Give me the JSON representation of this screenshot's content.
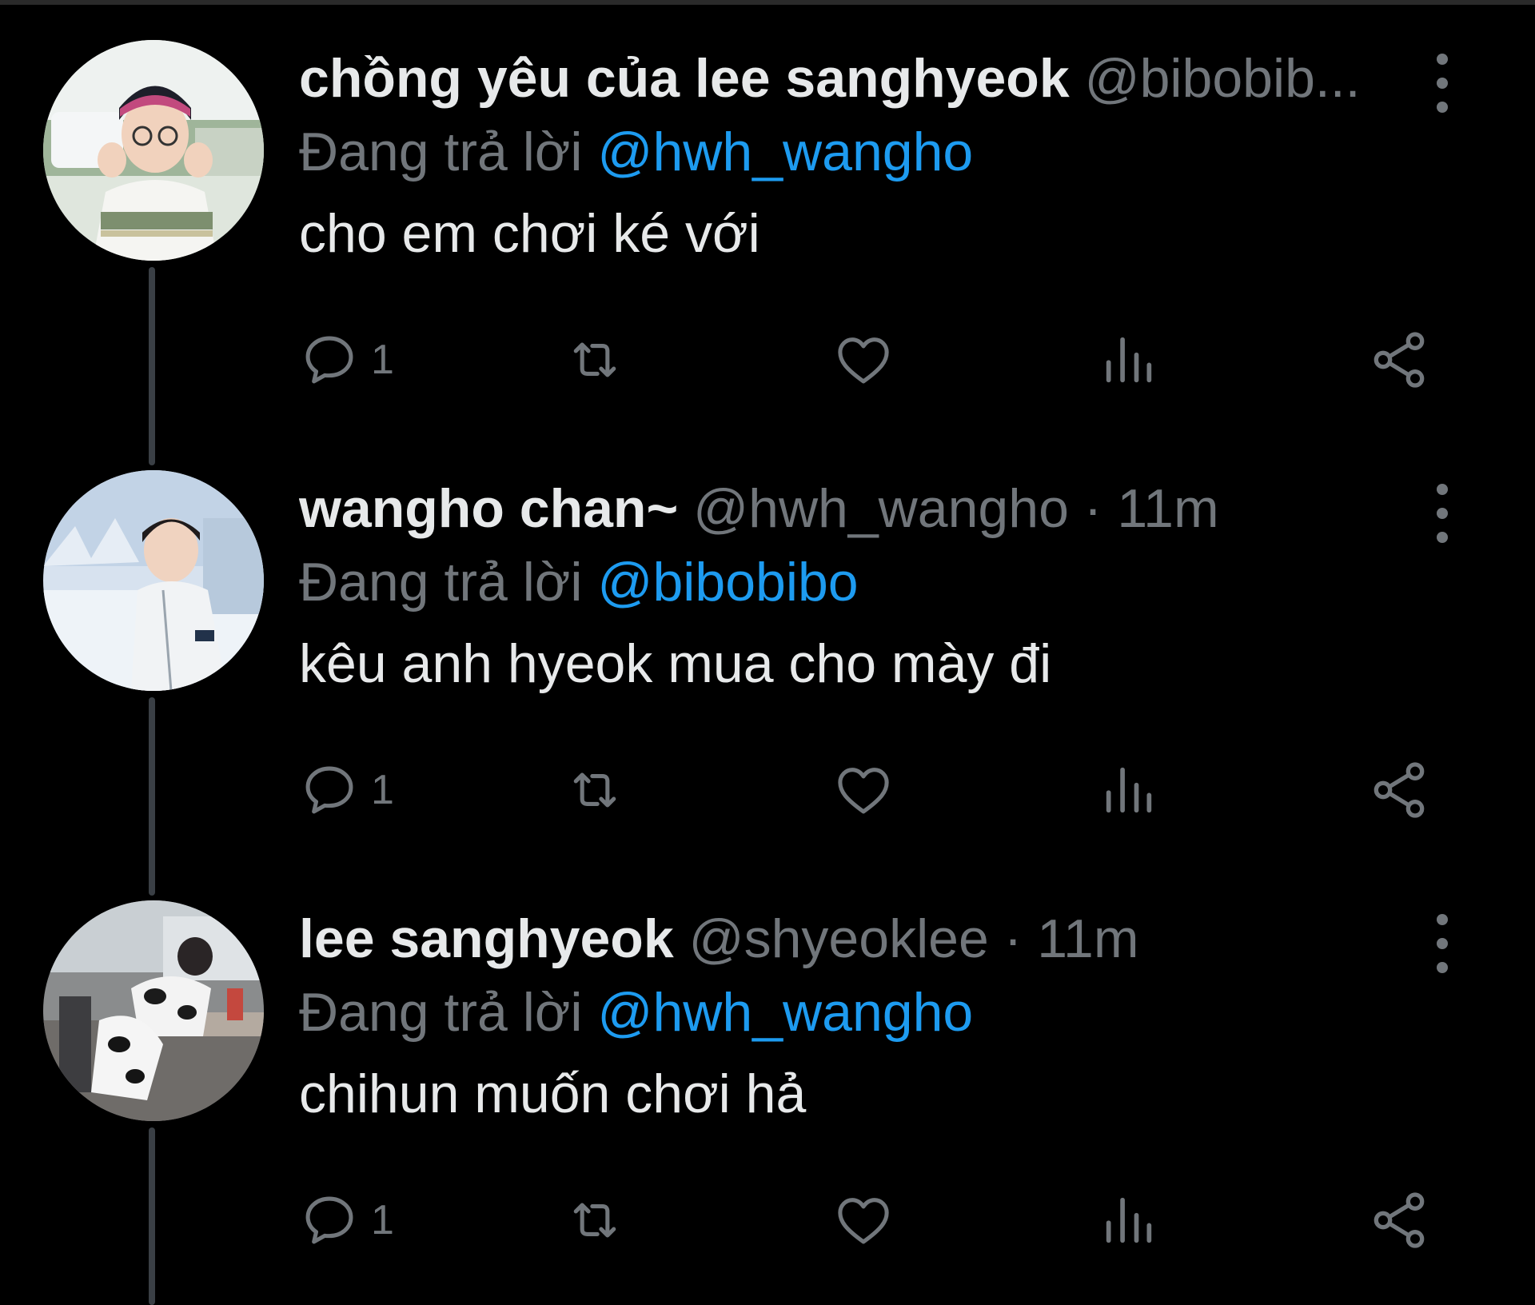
{
  "reply_prefix": "Đang trả lời",
  "tweets": [
    {
      "display_name": "chồng yêu của lee sanghyeok",
      "handle": "@bibobib...",
      "separator": "",
      "time": "",
      "reply_to": "@hwh_wangho",
      "text": "cho em chơi ké với",
      "reply_count": "1",
      "avatar_icon": "avatar-photo"
    },
    {
      "display_name": "wangho chan~",
      "handle": "@hwh_wangho",
      "separator": "·",
      "time": "11m",
      "reply_to": "@bibobibo",
      "text": "kêu anh hyeok mua cho mày đi",
      "reply_count": "1",
      "avatar_icon": "avatar-photo"
    },
    {
      "display_name": "lee sanghyeok",
      "handle": "@shyeoklee",
      "separator": "·",
      "time": "11m",
      "reply_to": "@hwh_wangho",
      "text": "chihun muốn chơi hả",
      "reply_count": "1",
      "avatar_icon": "avatar-photo"
    }
  ],
  "action_icons": [
    "reply-icon",
    "retweet-icon",
    "like-icon",
    "views-icon",
    "share-icon"
  ],
  "colors": {
    "background": "#000000",
    "primary_text": "#e7e9ea",
    "secondary_text": "#71767b",
    "accent": "#1d9bf0",
    "thread_line": "#3a3f45"
  }
}
